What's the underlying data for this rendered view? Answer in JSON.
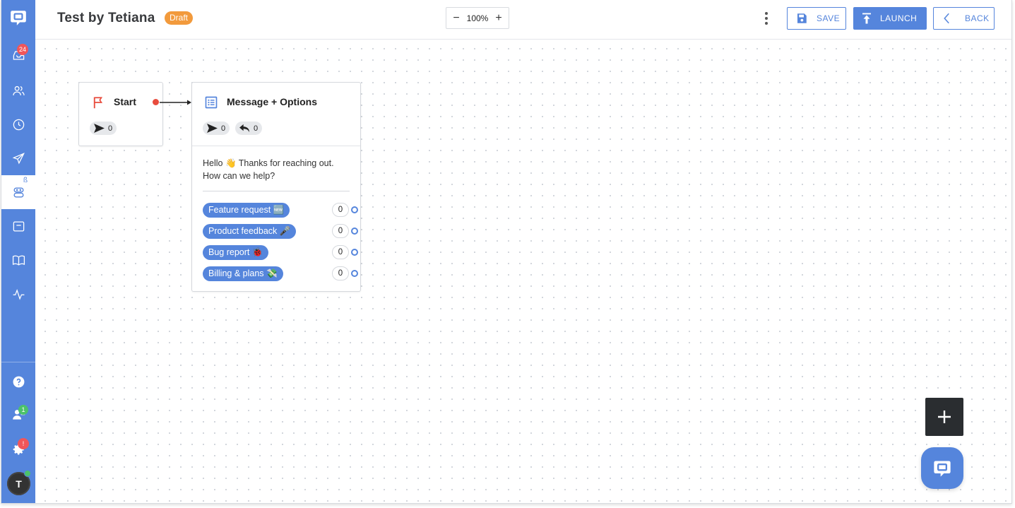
{
  "header": {
    "title": "Test by Tetiana",
    "status": "Draft",
    "zoom": "100%",
    "zoom_minus": "−",
    "zoom_plus": "+",
    "save_label": "SAVE",
    "launch_label": "LAUNCH",
    "back_label": "BACK"
  },
  "sidebar": {
    "inbox_badge": "24",
    "bots_beta": "ß",
    "team_badge": "1",
    "settings_badge": "!",
    "avatar_initial": "T",
    "items": [
      "logo-icon",
      "inbox-icon",
      "contacts-icon",
      "history-icon",
      "send-icon",
      "bot-icon",
      "widget-icon",
      "knowledge-base-icon",
      "activity-icon",
      "help-icon",
      "team-icon",
      "settings-icon"
    ]
  },
  "flow": {
    "start": {
      "title": "Start",
      "sent_count": "0"
    },
    "message": {
      "title": "Message + Options",
      "sent_count": "0",
      "reply_count": "0",
      "text": "Hello 👋 Thanks for reaching out. How can we help?",
      "options": [
        {
          "label": "Feature request 🆕",
          "count": "0"
        },
        {
          "label": "Product feedback 🎤",
          "count": "0"
        },
        {
          "label": "Bug report 🐞",
          "count": "0"
        },
        {
          "label": "Billing & plans 💸",
          "count": "0"
        }
      ]
    }
  },
  "colors": {
    "accent": "#5585dc",
    "draft": "#f29a3c",
    "start_flag": "#e84c3d",
    "badge_red": "#f0565a",
    "badge_green": "#4cc26b"
  }
}
